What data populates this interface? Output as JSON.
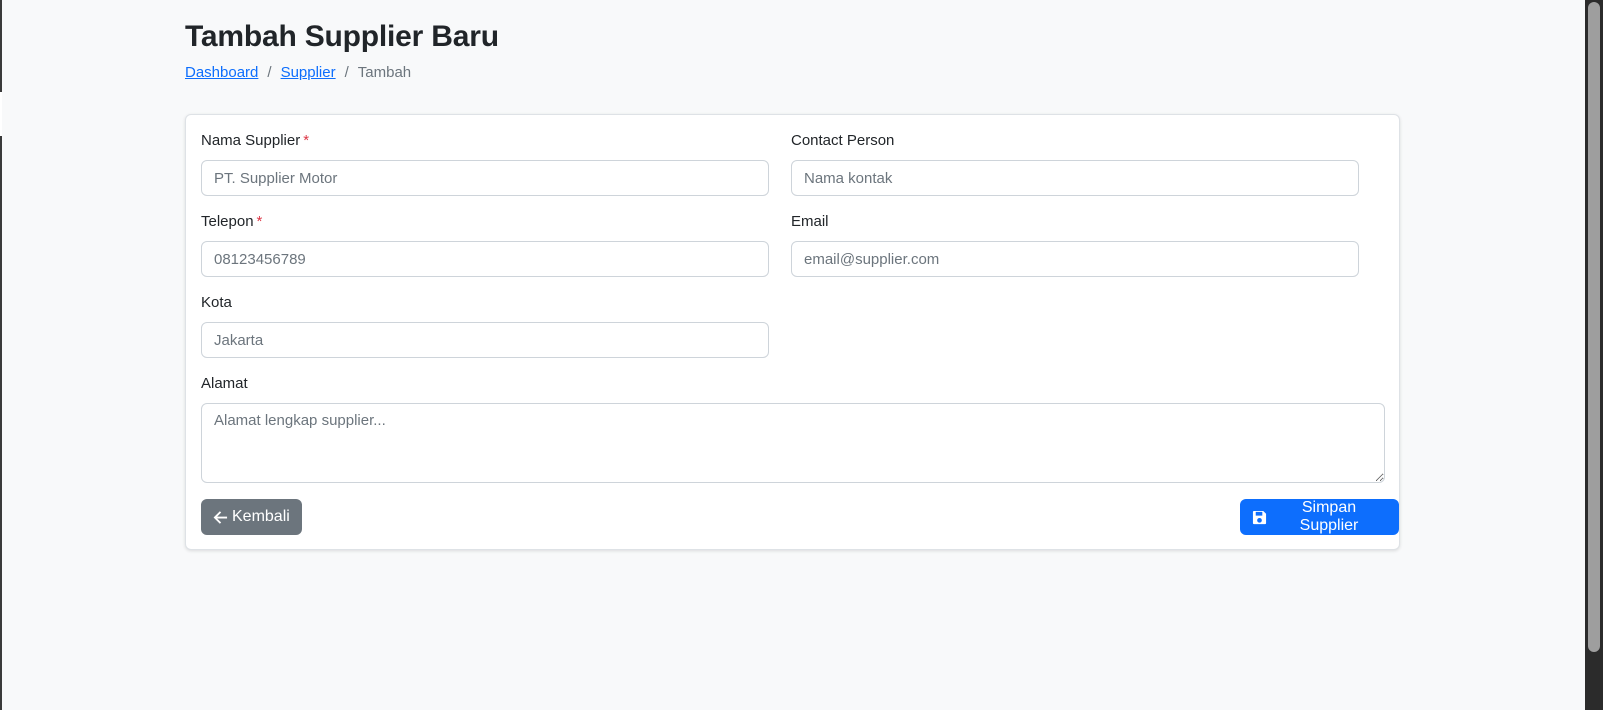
{
  "header": {
    "title": "Tambah Supplier Baru"
  },
  "breadcrumb": {
    "items": [
      "Dashboard",
      "Supplier"
    ],
    "separator": "/",
    "current": "Tambah"
  },
  "form": {
    "required_marker": "*",
    "nama_supplier": {
      "label": "Nama Supplier",
      "placeholder": "PT. Supplier Motor",
      "value": ""
    },
    "contact_person": {
      "label": "Contact Person",
      "placeholder": "Nama kontak",
      "value": ""
    },
    "telepon": {
      "label": "Telepon",
      "placeholder": "08123456789",
      "value": ""
    },
    "email": {
      "label": "Email",
      "placeholder": "email@supplier.com",
      "value": ""
    },
    "kota": {
      "label": "Kota",
      "placeholder": "Jakarta",
      "value": ""
    },
    "alamat": {
      "label": "Alamat",
      "placeholder": "Alamat lengkap supplier...",
      "value": ""
    }
  },
  "actions": {
    "back_label": "Kembali",
    "back_icon": "arrow-left-icon",
    "save_label": "Simpan Supplier",
    "save_icon": "floppy-disk-icon"
  },
  "colors": {
    "primary": "#0d6efd",
    "secondary": "#6c757d",
    "required": "#dc3545",
    "background": "#f8f9fa"
  }
}
